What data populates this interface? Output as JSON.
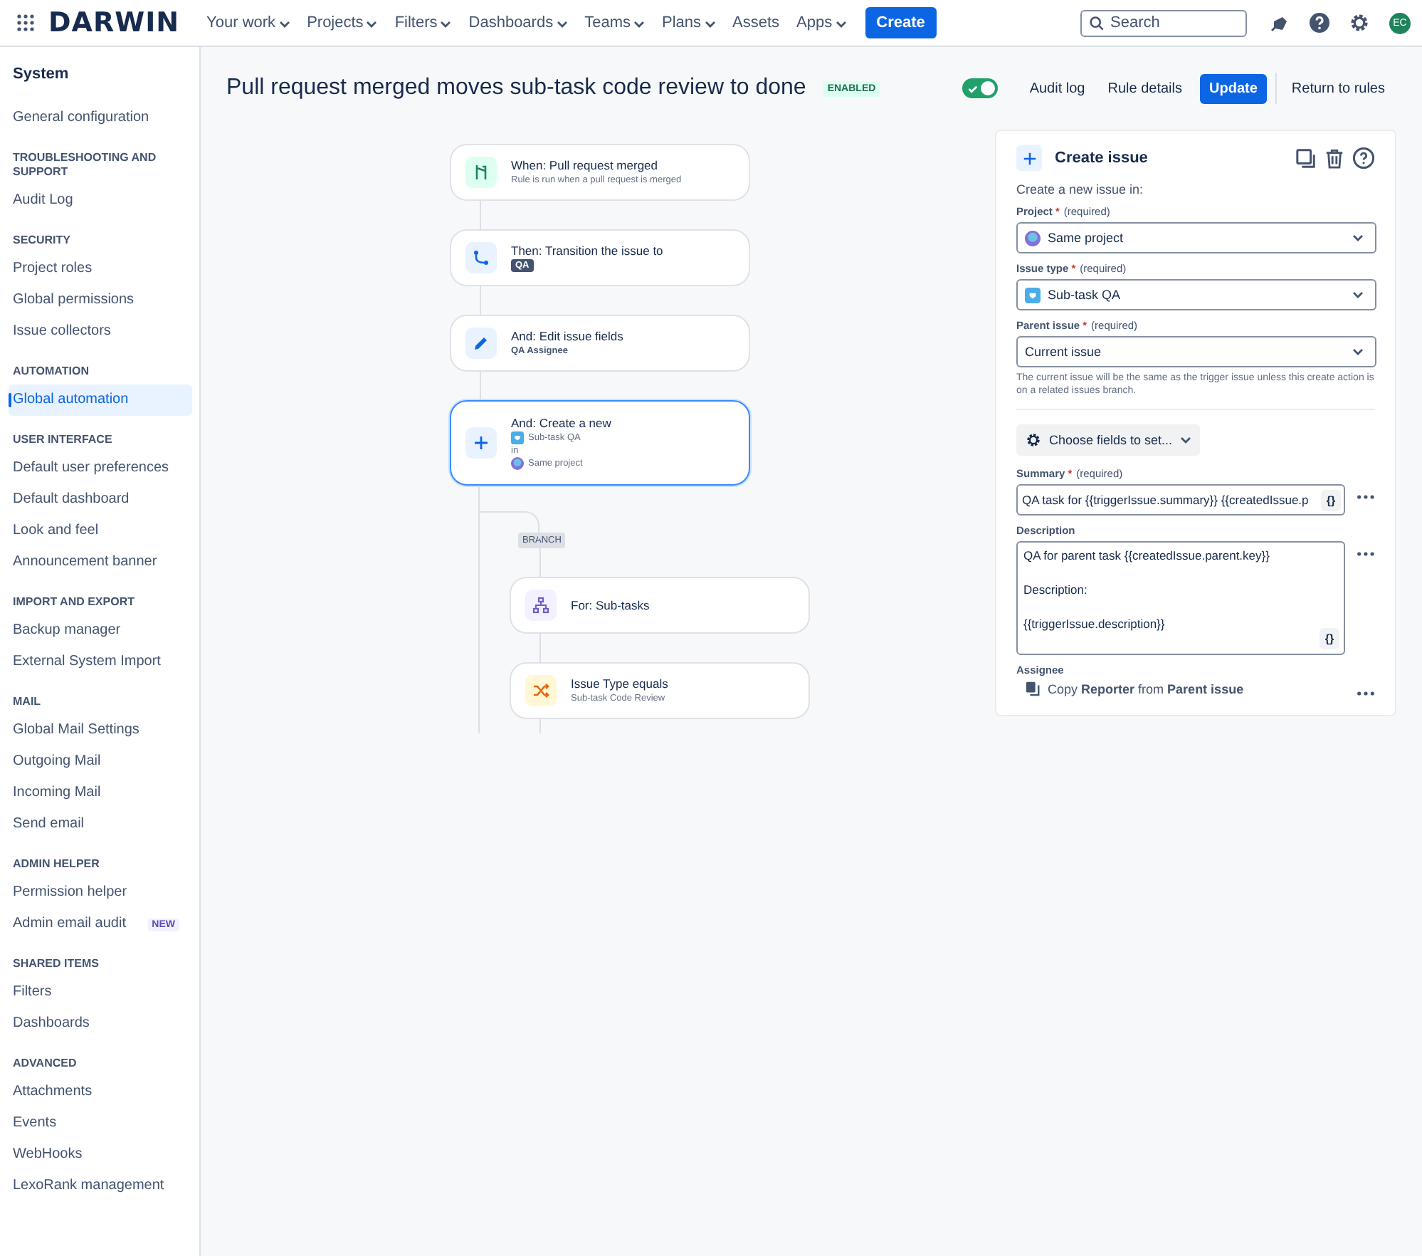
{
  "topbar": {
    "logo": "DARWIN",
    "nav": [
      {
        "label": "Your work",
        "menu": true
      },
      {
        "label": "Projects",
        "menu": true
      },
      {
        "label": "Filters",
        "menu": true
      },
      {
        "label": "Dashboards",
        "menu": true
      },
      {
        "label": "Teams",
        "menu": true
      },
      {
        "label": "Plans",
        "menu": true
      },
      {
        "label": "Assets",
        "menu": false
      },
      {
        "label": "Apps",
        "menu": true
      }
    ],
    "create": "Create",
    "search": {
      "placeholder": "Search"
    },
    "avatar": "EC"
  },
  "sidebar": {
    "title": "System",
    "sections": [
      {
        "items": [
          {
            "label": "General configuration",
            "selected": false
          }
        ]
      },
      {
        "heading": "TROUBLESHOOTING AND SUPPORT",
        "items": [
          {
            "label": "Audit Log",
            "selected": false
          }
        ]
      },
      {
        "heading": "SECURITY",
        "items": [
          {
            "label": "Project roles",
            "selected": false
          },
          {
            "label": "Global permissions",
            "selected": false
          },
          {
            "label": "Issue collectors",
            "selected": false
          }
        ]
      },
      {
        "heading": "AUTOMATION",
        "items": [
          {
            "label": "Global automation",
            "selected": true
          }
        ]
      },
      {
        "heading": "USER INTERFACE",
        "items": [
          {
            "label": "Default user preferences",
            "selected": false
          },
          {
            "label": "Default dashboard",
            "selected": false
          },
          {
            "label": "Look and feel",
            "selected": false
          },
          {
            "label": "Announcement banner",
            "selected": false
          }
        ]
      },
      {
        "heading": "IMPORT AND EXPORT",
        "items": [
          {
            "label": "Backup manager",
            "selected": false
          },
          {
            "label": "External System Import",
            "selected": false
          }
        ]
      },
      {
        "heading": "MAIL",
        "items": [
          {
            "label": "Global Mail Settings",
            "selected": false
          },
          {
            "label": "Outgoing Mail",
            "selected": false
          },
          {
            "label": "Incoming Mail",
            "selected": false
          },
          {
            "label": "Send email",
            "selected": false
          }
        ]
      },
      {
        "heading": "ADMIN HELPER",
        "items": [
          {
            "label": "Permission helper",
            "selected": false
          },
          {
            "label": "Admin email audit",
            "selected": false,
            "badge": "NEW"
          }
        ]
      },
      {
        "heading": "SHARED ITEMS",
        "items": [
          {
            "label": "Filters",
            "selected": false
          },
          {
            "label": "Dashboards",
            "selected": false
          }
        ]
      },
      {
        "heading": "ADVANCED",
        "items": [
          {
            "label": "Attachments",
            "selected": false
          },
          {
            "label": "Events",
            "selected": false
          },
          {
            "label": "WebHooks",
            "selected": false
          },
          {
            "label": "LexoRank management",
            "selected": false
          }
        ]
      }
    ]
  },
  "header": {
    "title": "Pull request merged moves sub-task code review to done",
    "status": "ENABLED",
    "toggle": {
      "on": true
    },
    "actions": [
      {
        "label": "Audit log",
        "kind": "link"
      },
      {
        "label": "Rule details",
        "kind": "link"
      },
      {
        "label": "Update",
        "kind": "primary"
      },
      {
        "label": "Return to rules",
        "kind": "link"
      }
    ]
  },
  "flow": {
    "nodes": [
      {
        "kind": "trigger",
        "title": "When: Pull request merged",
        "subtitle": "Rule is run when a pull request is merged",
        "selected": false
      },
      {
        "kind": "transition",
        "title": "Then: Transition the issue to",
        "lozenge": "QA",
        "selected": false
      },
      {
        "kind": "edit",
        "title": "And: Edit issue fields",
        "note": "QA Assignee",
        "selected": false
      },
      {
        "kind": "create",
        "title": "And: Create a new",
        "selected": true,
        "lines": [
          {
            "kind": "issue_type",
            "text": "Sub-task QA"
          },
          {
            "kind": "plain",
            "text": "in"
          },
          {
            "kind": "project",
            "text": "Same project"
          }
        ]
      }
    ],
    "branch": {
      "label": "BRANCH",
      "nodes": [
        {
          "kind": "for",
          "title": "For: Sub-tasks",
          "selected": false
        },
        {
          "kind": "condition",
          "title": "Issue Type equals",
          "subtitle": "Sub-task Code Review",
          "selected": false
        }
      ]
    }
  },
  "panel": {
    "title": "Create issue",
    "intro": "Create a new issue in:",
    "selects": [
      {
        "label": "Project",
        "mark": "*",
        "hint": "(required)",
        "value": "Same project",
        "kind": "project"
      },
      {
        "label": "Issue type",
        "mark": "*",
        "hint": "(required)",
        "value": "Sub-task QA",
        "kind": "issue_type"
      },
      {
        "label": "Parent issue",
        "mark": "*",
        "hint": "(required)",
        "value": "Current issue",
        "kind": "plain",
        "help": "The current issue will be the same as the trigger issue unless this create action is on a related issues branch."
      }
    ],
    "choose": "Choose fields to set...",
    "summary": {
      "label": "Summary",
      "mark": "*",
      "hint": "(required)",
      "value": "QA task for {{triggerIssue.summary}} {{createdIssue.p",
      "braces": "{}"
    },
    "description": {
      "label": "Description",
      "lines": [
        "QA for parent task {{createdIssue.parent.key}}",
        "Description:",
        "{{triggerIssue.description}}"
      ],
      "braces": "{}"
    },
    "assignee": {
      "label": "Assignee",
      "value": "Copy **Reporter** from **Parent issue**"
    }
  }
}
